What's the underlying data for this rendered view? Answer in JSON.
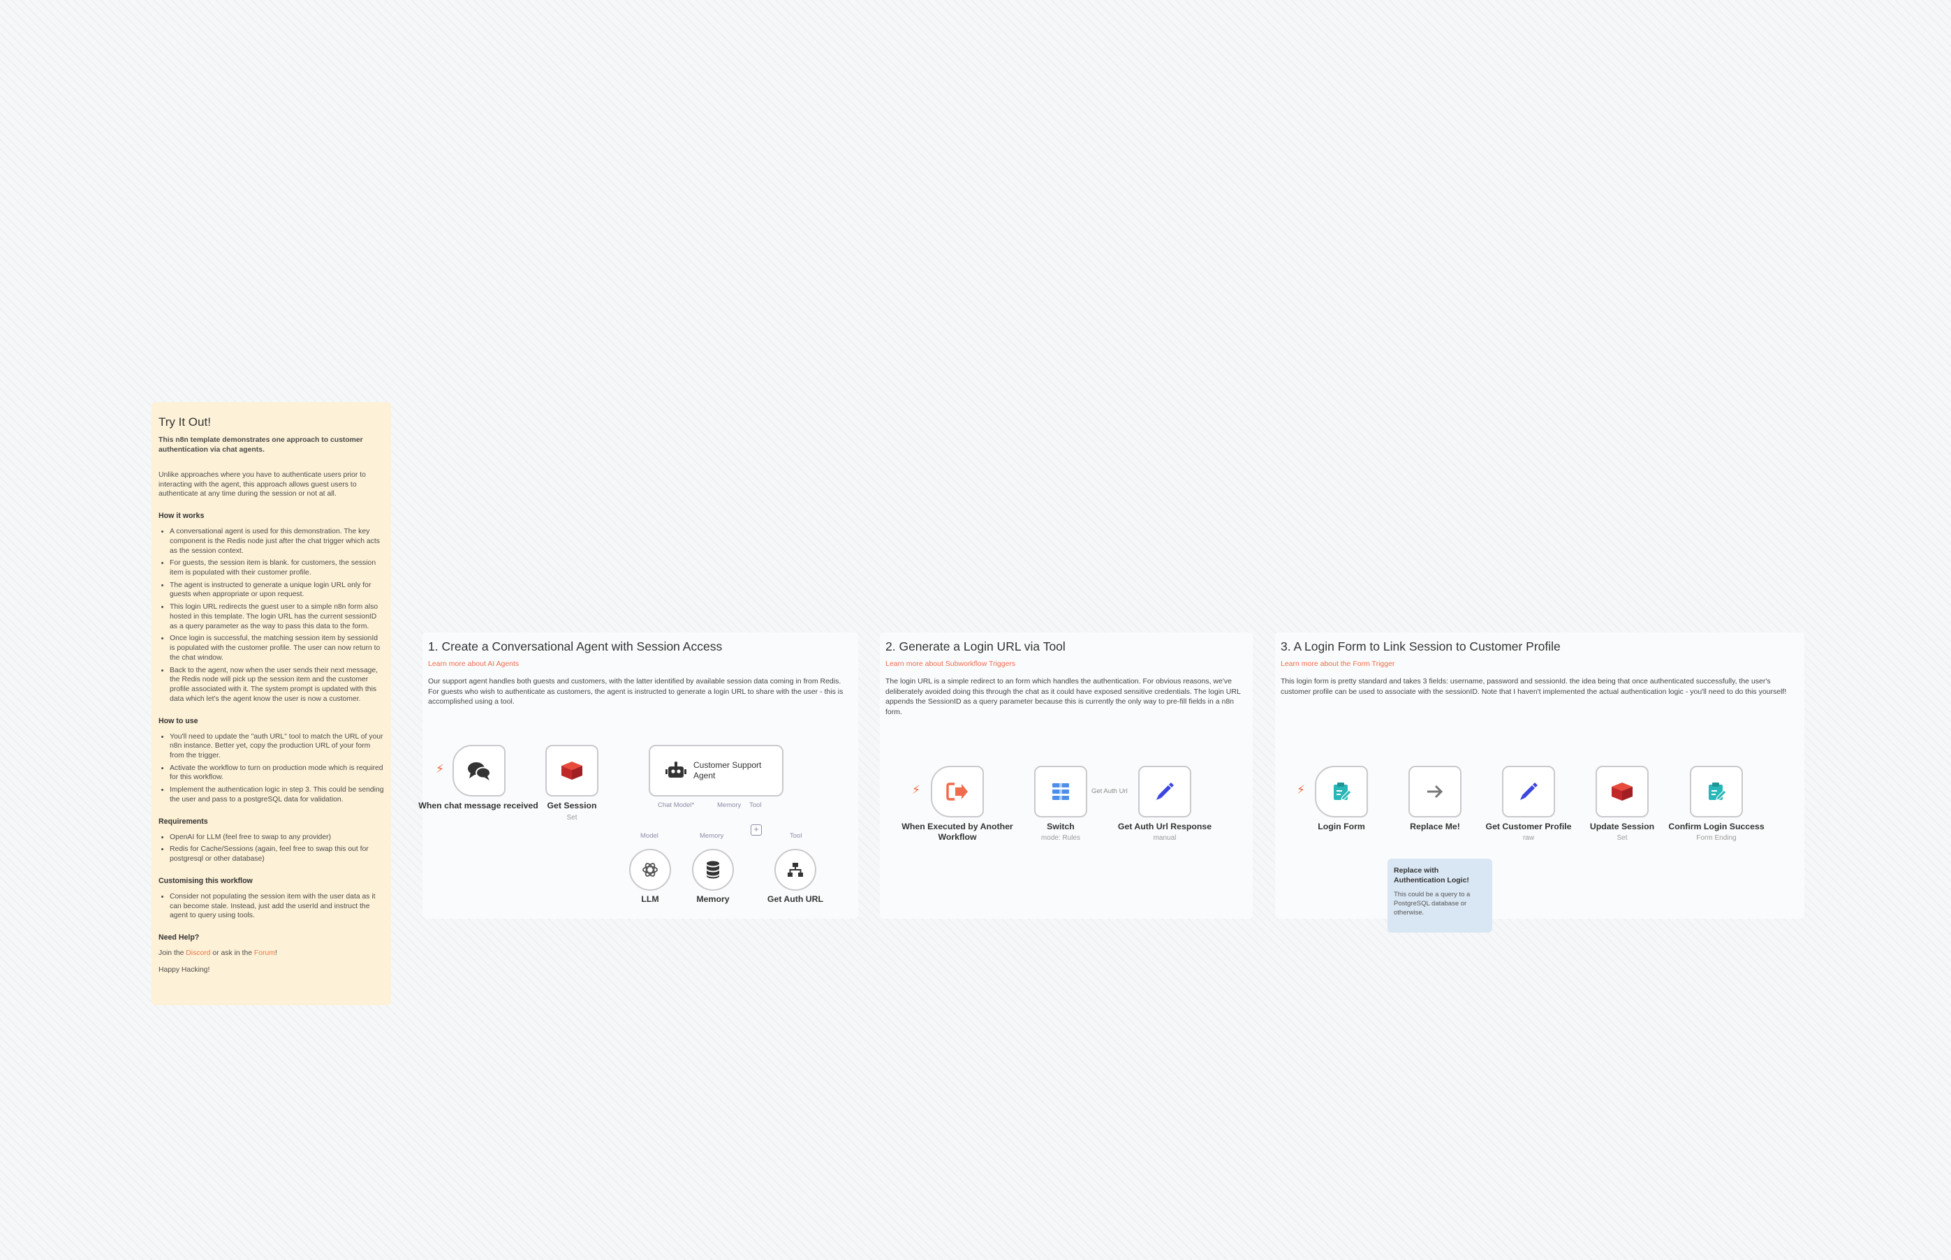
{
  "try_note": {
    "title": "Try It Out!",
    "lead": "This n8n template demonstrates one approach to customer authentication via chat agents.",
    "intro": "Unlike approaches where you have to authenticate users prior to interacting with the agent, this approach allows guest users to authenticate at any time during the session or not at all.",
    "how_it_works_title": "How it works",
    "how_it_works": [
      "A conversational agent is used for this demonstration. The key component is the Redis node just after the chat trigger which acts as the session context.",
      "For guests, the session item is blank. for customers, the session item is populated with their customer profile.",
      "The agent is instructed to generate a unique login URL only for guests when appropriate or upon request.",
      "This login URL redirects the guest user to a simple n8n form also hosted in this template. The login URL has the current sessionID as a query parameter as the way to pass this data to the form.",
      "Once login is successful, the matching session item by sessionId is populated with the customer profile. The user can now return to the chat window.",
      "Back to the agent, now when the user sends their next message, the Redis node will pick up the session item and the customer profile associated with it. The system prompt is updated with this data which let's the agent know the user is now a customer."
    ],
    "how_to_use_title": "How to use",
    "how_to_use": [
      "You'll need to update the \"auth URL\" tool to match the URL of your n8n instance. Better yet, copy the production URL of your form from the trigger.",
      "Activate the workflow to turn on production mode which is required for this workflow.",
      "Implement the authentication logic in step 3. This could be sending the user and pass to a postgreSQL data for validation."
    ],
    "requirements_title": "Requirements",
    "requirements": [
      "OpenAI for LLM (feel free to swap to any provider)",
      "Redis for Cache/Sessions (again, feel free to swap this out for postgresql or other database)"
    ],
    "customising_title": "Customising this workflow",
    "customising": [
      "Consider not populating the session item with the user data as it can become stale. Instead, just add the userId and instruct the agent to query using tools."
    ],
    "help_title": "Need Help?",
    "help_prefix": "Join the ",
    "help_discord": "Discord",
    "help_mid": " or ask in the ",
    "help_forum": "Forum",
    "help_suffix": "!",
    "sign_off": "Happy Hacking!"
  },
  "sections": [
    {
      "title": "1. Create a Conversational Agent with Session Access",
      "learn": "Learn more about AI Agents",
      "desc": "Our support agent handles both guests and customers, with the latter identified by available session data coming in from Redis. For guests who wish to authenticate as customers, the agent is instructed to generate a login URL to share with the user - this is accomplished using a tool."
    },
    {
      "title": "2. Generate a Login URL via Tool",
      "learn": "Learn more about Subworkflow Triggers",
      "desc": "The login URL is a simple redirect to an form which handles the authentication. For obvious reasons, we've deliberately avoided doing this through the chat as it could have exposed sensitive credentials. The login URL appends the SessionID as a query parameter because this is currently the only way to pre-fill fields in a n8n form."
    },
    {
      "title": "3. A Login Form to Link Session to Customer Profile",
      "learn": "Learn more about the Form Trigger",
      "desc": "This login form is pretty standard and takes 3 fields: username, password and sessionId. the idea being that once authenticated successfully, the user's customer profile can be used to associate with the sessionID. Note that I haven't implemented the actual authentication logic - you'll need to do this yourself!"
    }
  ],
  "nodes": {
    "chat_trigger": {
      "label": "When chat message received"
    },
    "get_session": {
      "label": "Get Session",
      "sub": "Set"
    },
    "agent": {
      "label": "Customer Support Agent"
    },
    "llm": {
      "label": "LLM"
    },
    "memory": {
      "label": "Memory"
    },
    "get_auth_url": {
      "label": "Get Auth URL"
    },
    "exec_trigger": {
      "label": "When Executed by Another Workflow"
    },
    "switch": {
      "label": "Switch",
      "sub": "mode: Rules"
    },
    "auth_response": {
      "label": "Get Auth Url Response",
      "sub": "manual"
    },
    "login_form": {
      "label": "Login Form"
    },
    "replace_me": {
      "label": "Replace Me!"
    },
    "get_profile": {
      "label": "Get Customer Profile",
      "sub": "raw"
    },
    "update_session": {
      "label": "Update Session",
      "sub": "Set"
    },
    "confirm_login": {
      "label": "Confirm Login Success",
      "sub": "Form Ending"
    }
  },
  "ports": {
    "chat_model": "Chat Model*",
    "memory": "Memory",
    "tool": "Tool",
    "model": "Model",
    "memory_sub": "Memory",
    "tool_sub": "Tool"
  },
  "edge_labels": {
    "get_auth_url": "Get Auth Url"
  },
  "blue_note": {
    "title": "Replace with Authentication Logic!",
    "body": "This could be a query to a PostgreSQL database or otherwise."
  },
  "colors": {
    "note_yellow": "#fdf1d7",
    "note_blue": "#d9e6f3",
    "accent_orange": "#ef6c4d",
    "redis_red": "#d42b2b",
    "form_teal": "#28b7b8",
    "edit_blue": "#3b46e0"
  }
}
